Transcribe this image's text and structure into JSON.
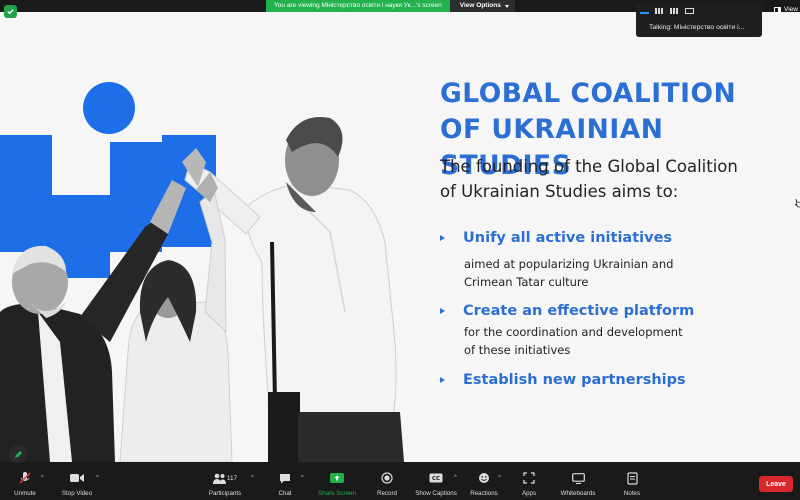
{
  "top_banner": {
    "viewing_text": "You are viewing Міністерство освіти і науки Ук...'s screen",
    "view_options_label": "View Options"
  },
  "speaker_panel": {
    "talking_text": "Talking: Міністерство освіти і...",
    "view_label": "View"
  },
  "slide": {
    "title_line1": "GLOBAL COALITION",
    "title_line2": "OF UKRAINIAN STUDIES",
    "intro_line1": "The founding of the Global Coalition",
    "intro_line2": "of Ukrainian Studies aims to:",
    "bullets": [
      {
        "heading": "Unify all active initiatives",
        "line1": "aimed at popularizing Ukrainian and",
        "line2": "Crimean Tatar culture"
      },
      {
        "heading": "Create an effective platform",
        "line1": "for the coordination and development",
        "line2": "of these initiatives"
      },
      {
        "heading": "Establish new partnerships",
        "line1": "",
        "line2": ""
      }
    ],
    "accent_color": "#2b6fd4"
  },
  "toolbar": {
    "unmute": "Unmute",
    "stop_video": "Stop Video",
    "participants": "Participants",
    "participants_count": "117",
    "chat": "Chat",
    "share_screen": "Share Screen",
    "record": "Record",
    "show_captions": "Show Captions",
    "reactions": "Reactions",
    "apps": "Apps",
    "whiteboards": "Whiteboards",
    "notes": "Notes",
    "leave": "Leave"
  },
  "colors": {
    "leave": "#d9272e",
    "share": "#23b14d",
    "toolbar_bg": "#1a1a1a"
  }
}
